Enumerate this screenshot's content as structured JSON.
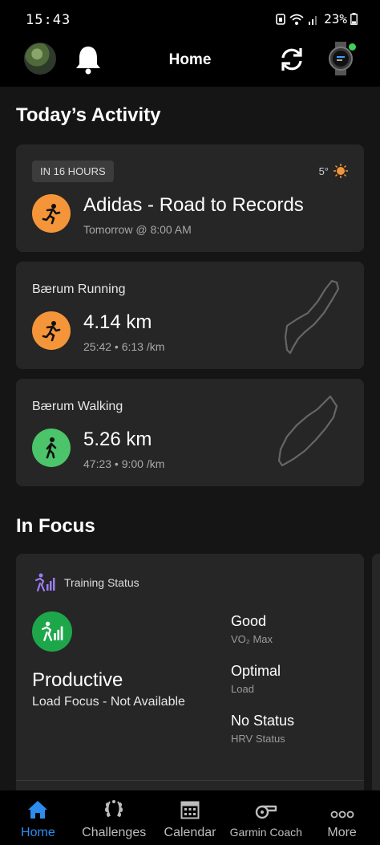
{
  "status_bar": {
    "time": "15:43",
    "battery": "23%"
  },
  "header": {
    "title": "Home"
  },
  "sections": {
    "todays_activity": "Today’s Activity",
    "in_focus": "In Focus"
  },
  "planned": {
    "tag": "IN 16 HOURS",
    "temperature": "5°",
    "title": "Adidas - Road to Records",
    "when": "Tomorrow @ 8:00 AM",
    "accent": "#f5953a"
  },
  "activities": [
    {
      "label": "Bærum Running",
      "distance": "4.14 km",
      "details": "25:42 • 6:13 /km",
      "icon": "running-icon",
      "color": "#f5953a"
    },
    {
      "label": "Bærum Walking",
      "distance": "5.26 km",
      "details": "47:23 • 9:00 /km",
      "icon": "walking-icon",
      "color": "#4bc46a"
    }
  ],
  "training_status": {
    "label": "Training Status",
    "status": "Productive",
    "load_focus": "Load Focus - Not Available",
    "metrics": [
      {
        "value": "Good",
        "label": "VO₂ Max"
      },
      {
        "value": "Optimal",
        "label": "Load"
      },
      {
        "value": "No Status",
        "label": "HRV Status"
      }
    ]
  },
  "nav": [
    {
      "label": "Home",
      "icon": "home-icon",
      "active": true
    },
    {
      "label": "Challenges",
      "icon": "laurel-icon"
    },
    {
      "label": "Calendar",
      "icon": "calendar-icon"
    },
    {
      "label": "Garmin Coach",
      "icon": "whistle-icon"
    },
    {
      "label": "More",
      "icon": "more-dots-icon"
    }
  ],
  "colors": {
    "accent_blue": "#2d8cf0",
    "productive_green": "#1ea74a",
    "background": "#151515",
    "card": "#262626"
  }
}
